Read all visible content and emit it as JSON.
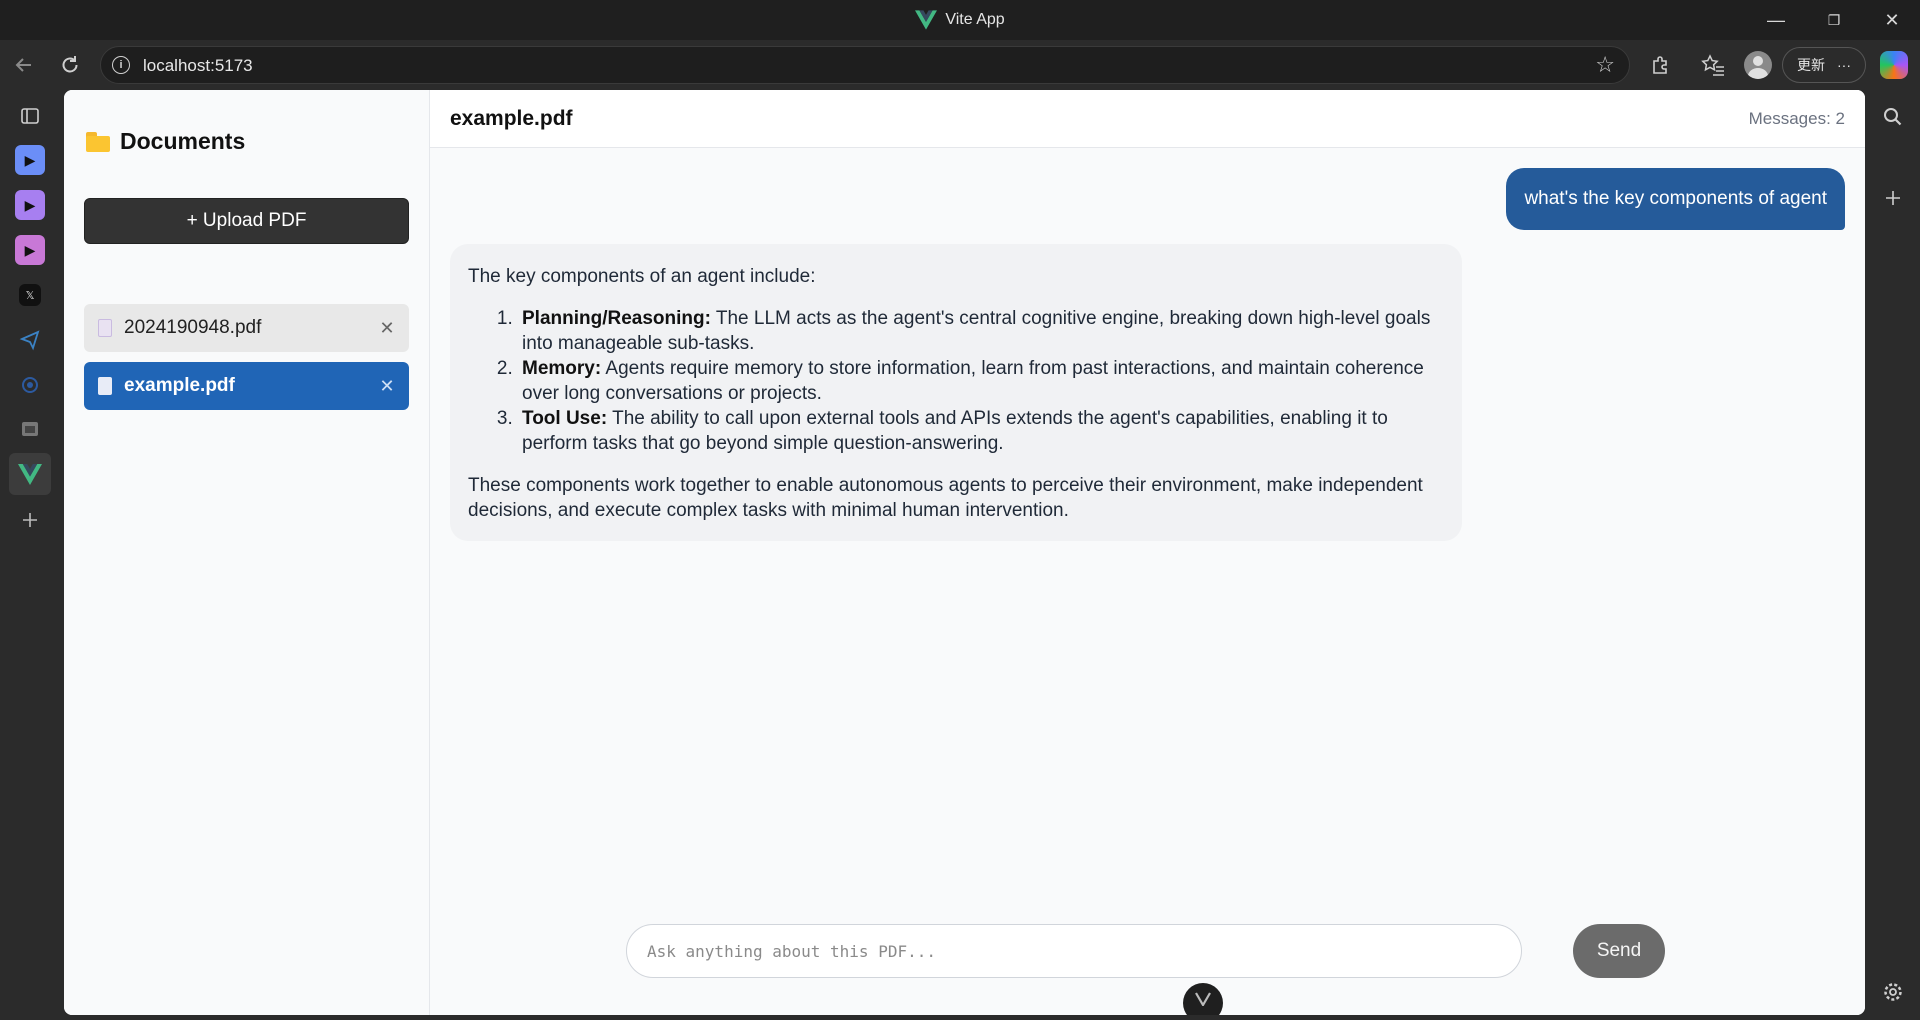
{
  "window": {
    "title": "Vite App",
    "controls": {
      "minimize": "—",
      "restore": "❐",
      "close": "✕"
    }
  },
  "browser": {
    "url": "localhost:5173",
    "info_icon": "i",
    "update_label": "更新",
    "more_label": "···"
  },
  "sidebar": {
    "title": "Documents",
    "upload_label": "+ Upload PDF",
    "files": [
      {
        "name": "2024190948.pdf",
        "close": "✕",
        "active": false
      },
      {
        "name": "example.pdf",
        "close": "✕",
        "active": true
      }
    ]
  },
  "chat": {
    "document_name": "example.pdf",
    "message_count": "Messages: 2",
    "user_message": "what's the key components of agent",
    "answer": {
      "intro": "The key components of an agent include:",
      "items": [
        {
          "term": "Planning/Reasoning:",
          "text": " The LLM acts as the agent's central cognitive engine, breaking down high-level goals into manageable sub-tasks."
        },
        {
          "term": "Memory:",
          "text": " Agents require memory to store information, learn from past interactions, and maintain coherence over long conversations or projects."
        },
        {
          "term": "Tool Use:",
          "text": " The ability to call upon external tools and APIs extends the agent's capabilities, enabling it to perform tasks that go beyond simple question-answering."
        }
      ],
      "conclusion": "These components work together to enable autonomous agents to perceive their environment, make independent decisions, and execute complex tasks with minimal human intervention."
    },
    "input_placeholder": "Ask anything about this PDF...",
    "send_label": "Send"
  },
  "colors": {
    "accent": "#2065b6",
    "user_bubble": "#255b9a",
    "upload_button": "#333333",
    "send_button": "#6b6b6b",
    "vue_green": "#42b883"
  }
}
